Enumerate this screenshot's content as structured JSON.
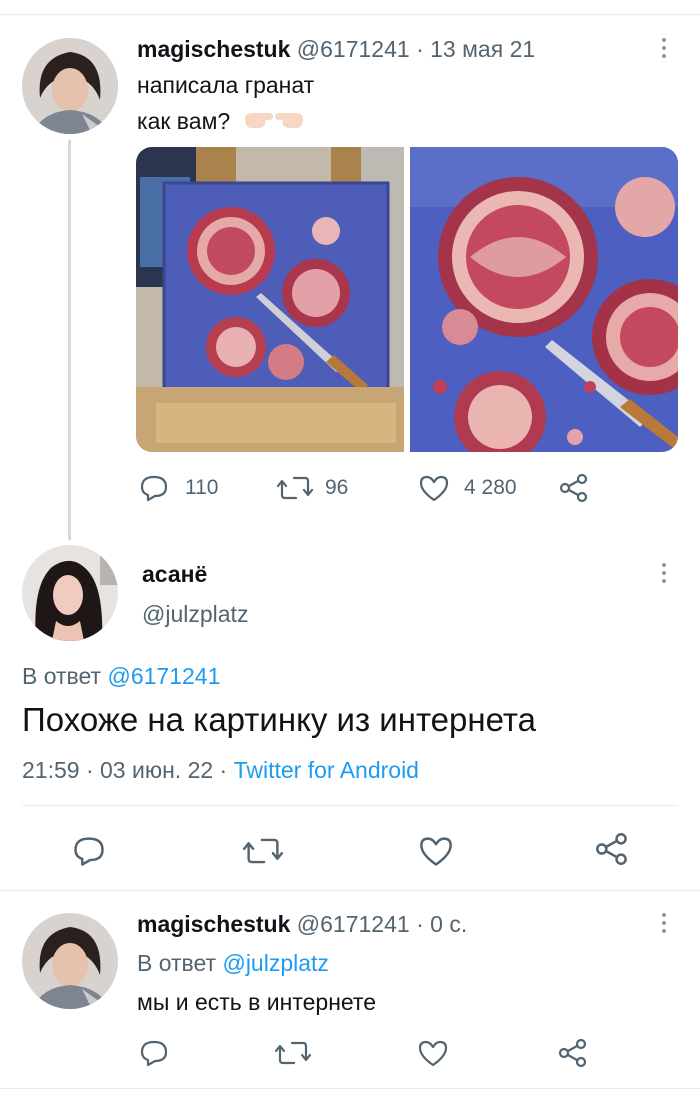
{
  "tweet1": {
    "name": "magischestuk",
    "handle": "@6171241",
    "sep": "·",
    "date": "13 мая 21",
    "line1": "написала гранат",
    "line2": "как вам?",
    "emoji": "pointing-hands-emoji",
    "stats": {
      "replies": "110",
      "retweets": "96",
      "likes": "4 280"
    }
  },
  "tweet2": {
    "name": "асанё",
    "handle": "@julzplatz",
    "reply_prefix": "В ответ",
    "reply_to": "@6171241",
    "text": "Похоже на картинку из интернета",
    "time": "21:59",
    "sep1": "·",
    "date": "03 июн. 22",
    "sep2": "·",
    "client": "Twitter for Android"
  },
  "tweet3": {
    "name": "magischestuk",
    "handle": "@6171241",
    "sep": "·",
    "time": "0 с.",
    "reply_prefix": "В ответ",
    "reply_to": "@julzplatz",
    "text": "мы и есть в интернете"
  },
  "colors": {
    "accent": "#1d9bf0",
    "muted": "#536471",
    "divider": "#e6ecf0"
  }
}
